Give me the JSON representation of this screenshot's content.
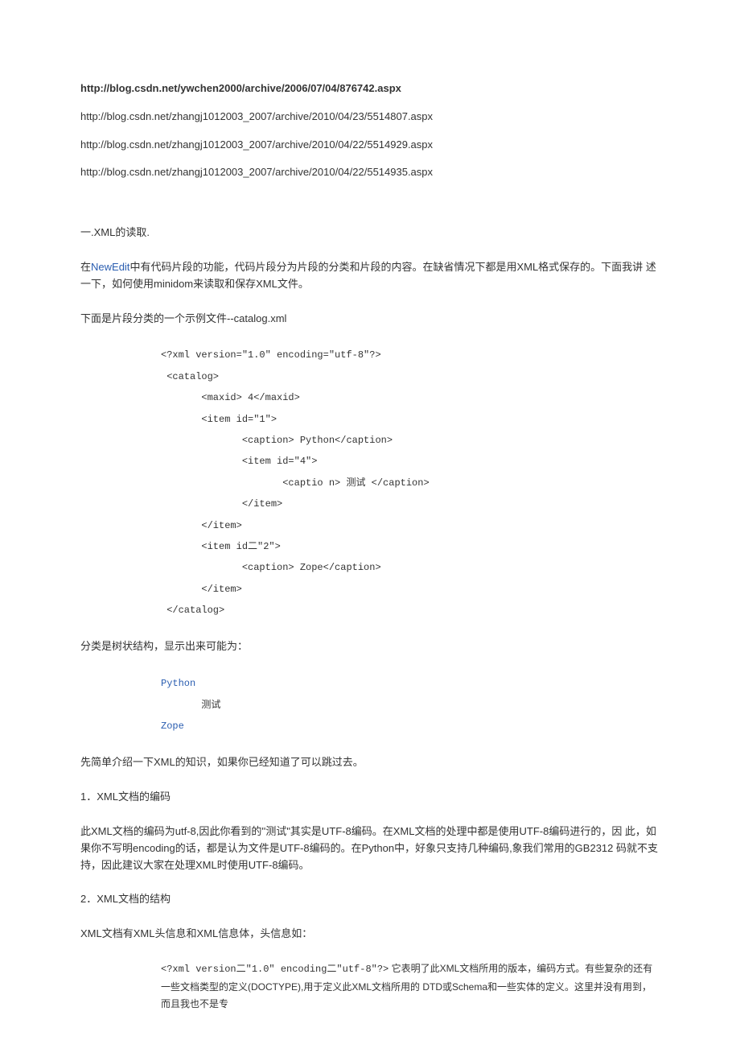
{
  "urls": [
    "http://blog.csdn.net/ywchen2000/archive/2006/07/04/876742.aspx",
    "http://blog.csdn.net/zhangj1012003_2007/archive/2010/04/23/5514807.aspx",
    "http://blog.csdn.net/zhangj1012003_2007/archive/2010/04/22/5514929.aspx",
    "http://blog.csdn.net/zhangj1012003_2007/archive/2010/04/22/5514935.aspx"
  ],
  "section1_title": "一.XML的读取.",
  "intro": {
    "prefix": "在",
    "link": "NewEdit",
    "suffix": "中有代码片段的功能，代码片段分为片段的分类和片段的内容。在缺省情况下都是用XML格式保存的。下面我讲 述一下，如何使用minidom来读取和保存XML文件。"
  },
  "example_intro": "下面是片段分类的一个示例文件--catalog.xml",
  "code_lines": [
    "<?xml version=\"1.0\" encoding=\"utf-8\"?>",
    " <catalog>",
    "       <maxid> 4</maxid>",
    "       <item id=\"1\">",
    "              <caption> Python</caption>",
    "              <item id=\"4\">",
    "                     <captio n> 测试 </caption>",
    "              </item>",
    "       </item>",
    "       <item id二\"2\">",
    "              <caption> Zope</caption>",
    "       </item>",
    " </catalog>"
  ],
  "tree_intro": "分类是树状结构，显示出来可能为：",
  "tree": [
    {
      "text": "Python",
      "link": true,
      "indent": 0
    },
    {
      "text": "测试",
      "link": false,
      "indent": 1
    },
    {
      "text": "Zope",
      "link": true,
      "indent": 0
    }
  ],
  "skip_note": "先简单介绍一下XML的知识，如果你已经知道了可以跳过去。",
  "h1": "1．XML文档的编码",
  "p1": "此XML文档的编码为utf-8,因此你看到的''测试\"其实是UTF-8编码。在XML文档的处理中都是使用UTF-8编码进行的，因 此，如果你不写明encoding的话，都是认为文件是UTF-8编码的。在Python中，好象只支持几种编码,象我们常用的GB2312 码就不支持，因此建议大家在处理XML时使用UTF-8编码。",
  "h2": "2．XML文档的结构",
  "p2": "XML文档有XML头信息和XML信息体，头信息如：",
  "quote": {
    "code": "<?xml version二\"1.0\" encoding二\"utf-8\"?>",
    "text": "   它表明了此XML文档所用的版本，编码方式。有些复杂的还有一些文档类型的定义(DOCTYPE),用于定义此XML文档所用的 DTD或Schema和一些实体的定义。这里并没有用到，而且我也不是专"
  }
}
